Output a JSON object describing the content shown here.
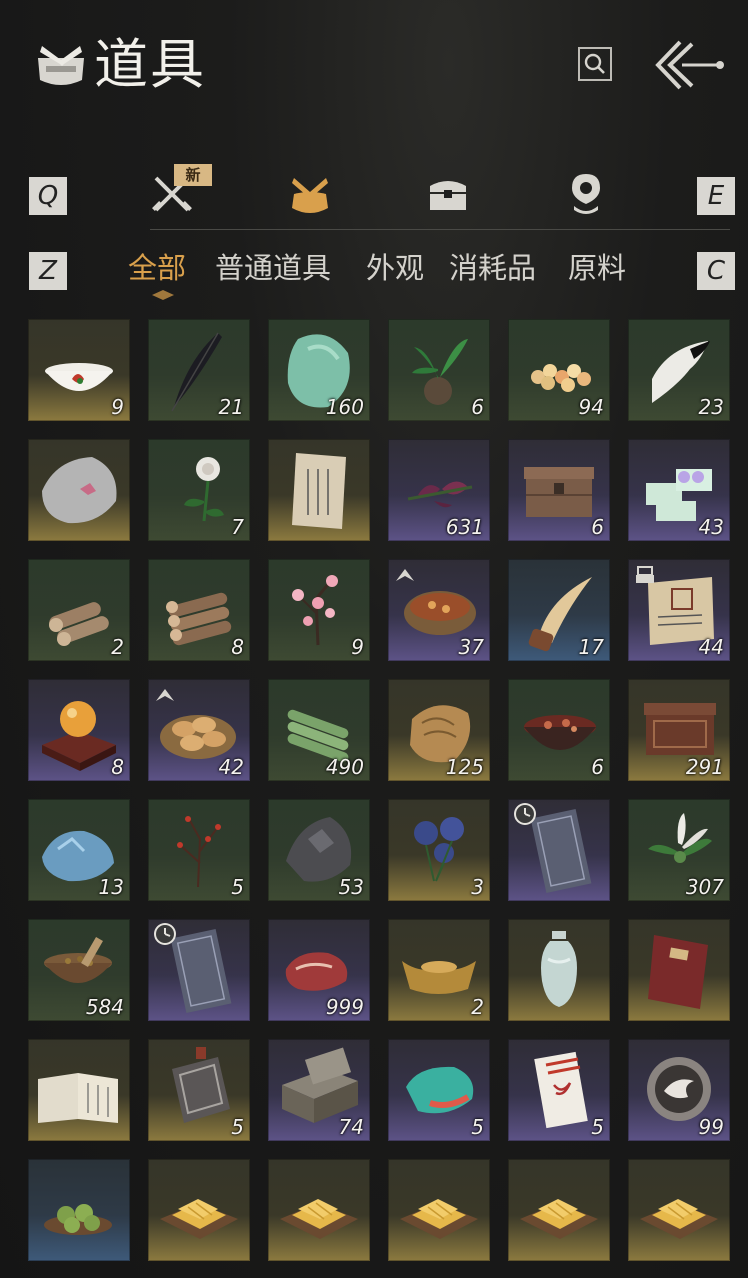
{
  "header": {
    "title": "道具",
    "title_icon": "bundle-icon",
    "search_icon": "search-icon",
    "back_icon": "back-arrow-icon"
  },
  "category_tabs": {
    "prev_key": "Q",
    "next_key": "E",
    "new_badge": "新",
    "tabs": [
      {
        "icon": "crossed-swords-icon",
        "active": false
      },
      {
        "icon": "bundle-bag-icon",
        "active": true
      },
      {
        "icon": "chest-icon",
        "active": false
      },
      {
        "icon": "map-pin-icon",
        "active": false
      }
    ]
  },
  "sub_tabs": {
    "prev_key": "Z",
    "next_key": "C",
    "tabs": [
      {
        "label": "全部",
        "active": true
      },
      {
        "label": "普通道具",
        "active": false
      },
      {
        "label": "外观",
        "active": false
      },
      {
        "label": "消耗品",
        "active": false
      },
      {
        "label": "原料",
        "active": false
      }
    ]
  },
  "colors": {
    "accent": "#d9a04c",
    "rarity_green": "#3e4a33",
    "rarity_gold": "#8c7a3f",
    "rarity_purple": "#5d5387",
    "rarity_blue": "#3e5a7a"
  },
  "items": [
    {
      "icon": "rooster-bowl-icon",
      "rarity": "gold",
      "qty": "9"
    },
    {
      "icon": "black-feather-icon",
      "rarity": "green",
      "qty": "21"
    },
    {
      "icon": "jade-stone-icon",
      "rarity": "green",
      "qty": "160"
    },
    {
      "icon": "potted-herb-icon",
      "rarity": "green",
      "qty": "6"
    },
    {
      "icon": "candy-pile-icon",
      "rarity": "green",
      "qty": "94"
    },
    {
      "icon": "white-fur-icon",
      "rarity": "green",
      "qty": "23"
    },
    {
      "icon": "silver-ore-icon",
      "rarity": "gold",
      "qty": ""
    },
    {
      "icon": "white-flower-icon",
      "rarity": "green",
      "qty": "7"
    },
    {
      "icon": "letter-paper-icon",
      "rarity": "gold",
      "qty": ""
    },
    {
      "icon": "purple-flower-icon",
      "rarity": "purple",
      "qty": "631"
    },
    {
      "icon": "wooden-chest-icon",
      "rarity": "purple",
      "qty": "6"
    },
    {
      "icon": "gift-box-icon",
      "rarity": "purple",
      "qty": "43"
    },
    {
      "icon": "log-pile-icon",
      "rarity": "green",
      "qty": "2"
    },
    {
      "icon": "log-bundle-icon",
      "rarity": "green",
      "qty": "8"
    },
    {
      "icon": "plum-blossom-icon",
      "rarity": "green",
      "qty": "9"
    },
    {
      "icon": "stew-pot-icon",
      "rarity": "purple",
      "qty": "37",
      "corner": "upgrade-icon"
    },
    {
      "icon": "horn-icon",
      "rarity": "blue",
      "qty": "17"
    },
    {
      "icon": "scroll-document-icon",
      "rarity": "purple",
      "qty": "44",
      "corner": "print-icon"
    },
    {
      "icon": "orb-stand-icon",
      "rarity": "purple",
      "qty": "8"
    },
    {
      "icon": "bun-basket-icon",
      "rarity": "purple",
      "qty": "42",
      "corner": "upgrade-icon"
    },
    {
      "icon": "bamboo-bundle-icon",
      "rarity": "green",
      "qty": "490"
    },
    {
      "icon": "carved-stone-icon",
      "rarity": "gold",
      "qty": "125"
    },
    {
      "icon": "meat-bowl-icon",
      "rarity": "green",
      "qty": "6"
    },
    {
      "icon": "carved-box-icon",
      "rarity": "gold",
      "qty": "291"
    },
    {
      "icon": "blue-crystal-icon",
      "rarity": "green",
      "qty": "13"
    },
    {
      "icon": "red-berry-branch-icon",
      "rarity": "green",
      "qty": "5"
    },
    {
      "icon": "dark-ore-icon",
      "rarity": "green",
      "qty": "53"
    },
    {
      "icon": "blue-flower-icon",
      "rarity": "gold",
      "qty": "3"
    },
    {
      "icon": "ticket-icon",
      "rarity": "purple",
      "qty": "",
      "corner": "clock-icon"
    },
    {
      "icon": "white-orchid-icon",
      "rarity": "green",
      "qty": "307"
    },
    {
      "icon": "mortar-herbs-icon",
      "rarity": "green",
      "qty": "584"
    },
    {
      "icon": "ticket-icon",
      "rarity": "purple",
      "qty": "",
      "corner": "clock-icon"
    },
    {
      "icon": "raw-meat-icon",
      "rarity": "purple",
      "qty": "999"
    },
    {
      "icon": "gold-ingot-icon",
      "rarity": "gold",
      "qty": "2"
    },
    {
      "icon": "porcelain-vase-icon",
      "rarity": "gold",
      "qty": ""
    },
    {
      "icon": "red-book-icon",
      "rarity": "gold",
      "qty": ""
    },
    {
      "icon": "open-book-icon",
      "rarity": "gold",
      "qty": ""
    },
    {
      "icon": "token-plaque-icon",
      "rarity": "gold",
      "qty": "5"
    },
    {
      "icon": "tool-case-icon",
      "rarity": "purple",
      "qty": "74"
    },
    {
      "icon": "gem-stone-icon",
      "rarity": "purple",
      "qty": "5"
    },
    {
      "icon": "red-envelope-icon",
      "rarity": "purple",
      "qty": "5"
    },
    {
      "icon": "bird-medal-icon",
      "rarity": "purple",
      "qty": "99"
    },
    {
      "icon": "green-dumplings-icon",
      "rarity": "blue",
      "qty": ""
    },
    {
      "icon": "cake-tray-icon",
      "rarity": "gold",
      "qty": ""
    },
    {
      "icon": "cake-tray-icon",
      "rarity": "gold",
      "qty": ""
    },
    {
      "icon": "cake-tray-icon",
      "rarity": "gold",
      "qty": ""
    },
    {
      "icon": "cake-tray-icon",
      "rarity": "gold",
      "qty": ""
    },
    {
      "icon": "cake-tray-icon",
      "rarity": "gold",
      "qty": ""
    }
  ]
}
